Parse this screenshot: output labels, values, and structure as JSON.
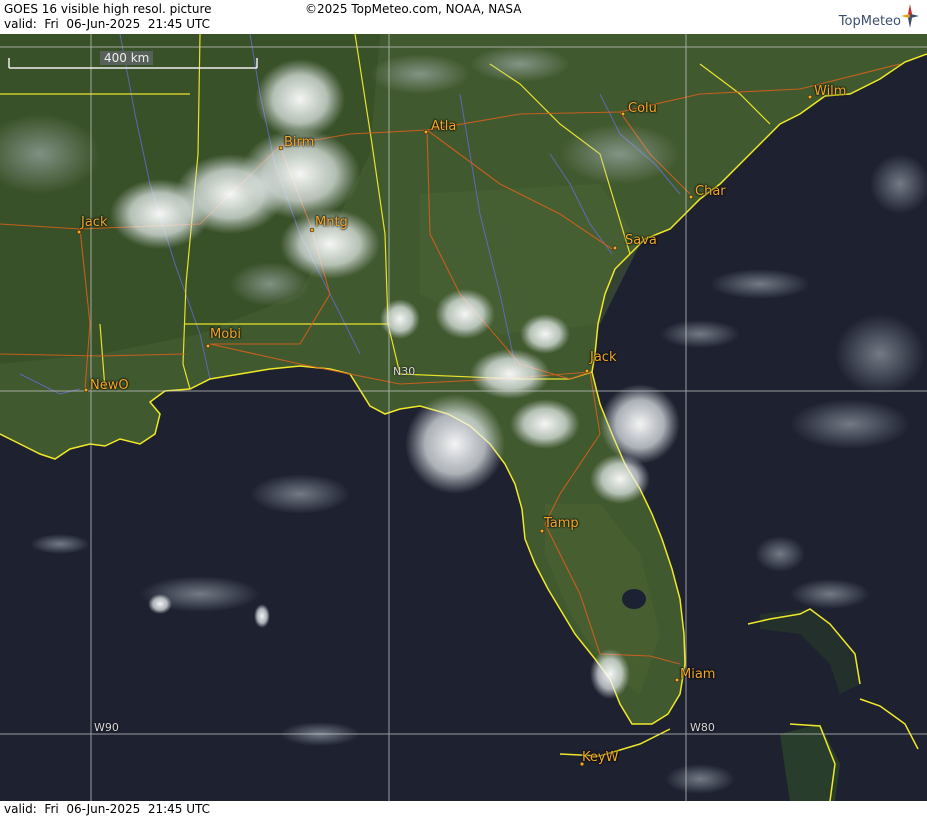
{
  "header": {
    "title": "GOES 16 visible high resol. picture",
    "valid": "valid:  Fri  06-Jun-2025  21:45 UTC",
    "copyright": "©2025 TopMeteo.com, NOAA, NASA",
    "logo": "TopMeteo"
  },
  "footer": {
    "valid": "valid:  Fri  06-Jun-2025  21:45 UTC"
  },
  "scale": {
    "label": "400 km"
  },
  "cities": {
    "wilm": "Wilm",
    "colu": "Colu",
    "atla": "Atla",
    "birm": "Birm",
    "char": "Char",
    "jack_ms": "Jack",
    "mntg": "Mntg",
    "sava": "Sava",
    "mobi": "Mobi",
    "newo": "NewO",
    "jack_fl": "Jack",
    "tamp": "Tamp",
    "miam": "Miam",
    "keyw": "KeyW"
  },
  "grid": {
    "n30": "N30",
    "w90": "W90",
    "w80": "W80"
  },
  "colors": {
    "land": "#3f5a2c",
    "ocean": "#1a1a26",
    "coast": "#f0e82a",
    "roads": "#d2601e",
    "cities": "#f2a728",
    "rivers": "#6a6ee0"
  }
}
